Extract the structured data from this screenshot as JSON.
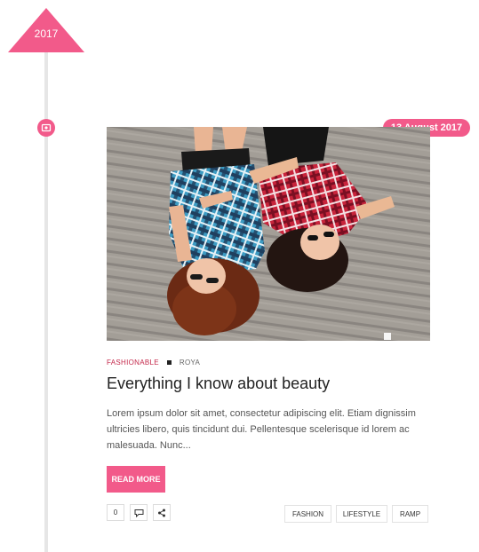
{
  "timeline": {
    "year": "2017"
  },
  "post": {
    "date": "13 August 2017",
    "category": "FASHIONABLE",
    "author": "ROYA",
    "title": "Everything I know about beauty",
    "excerpt": "Lorem ipsum dolor sit amet, consectetur adipiscing elit. Etiam dignissim ultricies libero, quis tincidunt dui. Pellentesque scelerisque id lorem ac malesuada. Nunc...",
    "read_more": "READ MORE",
    "like_count": "0",
    "tags": [
      "FASHION",
      "LIFESTYLE",
      "RAMP"
    ],
    "post_format_icon": "image-icon",
    "comment_icon": "comment-icon",
    "share_icon": "share-icon"
  },
  "colors": {
    "accent": "#f25a8a",
    "category": "#c4294b",
    "timeline": "#e6e6e6"
  }
}
